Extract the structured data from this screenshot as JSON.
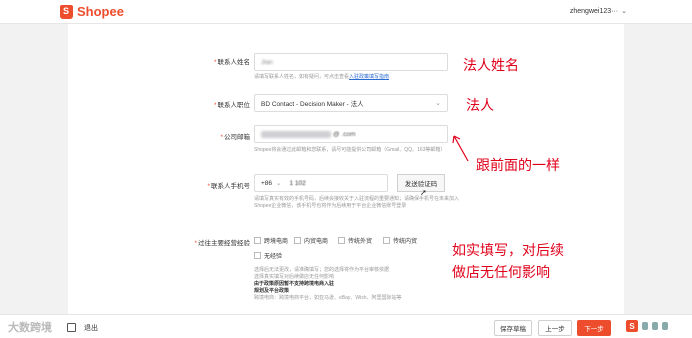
{
  "brand": {
    "name": "Shopee"
  },
  "user": {
    "name": "zhengwei123···"
  },
  "form": {
    "contact_name": {
      "label": "联系人姓名",
      "value_visible": "Jian",
      "hint_prefix": "请填写联系人姓名，如有疑问，可点击查看",
      "hint_link": "入驻政策填写指南"
    },
    "contact_title": {
      "label": "联系人职位",
      "value": "BD Contact - Decision Maker - 法人"
    },
    "company_email": {
      "label": "公司邮箱",
      "value_visible": "@    .com",
      "hint": "Shopee将会通过此邮箱和您联系，请尽可能提供公司邮箱（Gmail、QQ、163等邮箱）"
    },
    "contact_phone": {
      "label": "联系人手机号",
      "country_code": "+86",
      "value_visible": "1   102",
      "send_code_label": "发送验证码",
      "hint": "请填写真实有效的手机号码，后续会接收关于入驻流程的重要通知；请确保手机号在未来加入Shopee企业微信，该手机号也将作为后续用于平台企业微信账号登录"
    },
    "experience": {
      "label": "过往主要经营经验",
      "options": [
        "跨境电商",
        "内贸电商",
        "传统外贸",
        "传统内贸",
        "无经验"
      ],
      "hint_line1": "选择后无法更改，请准确填写；您的选择将作为平台审核依据",
      "hint_line2": "选择真实填写对后续做店无任何影响",
      "hint_bold1": "由于政策原因暂不支持跨境电商入驻",
      "hint_bold2": "规划及平台政策",
      "hint_line3": "跨境电商：跨境电商平台，如亚马逊、eBay、Wish、阿里国际站等"
    }
  },
  "annotations": {
    "name": "法人姓名",
    "title": "法人",
    "email_phone": "跟前面的一样",
    "experience_line1": "如实填写，对后续",
    "experience_line2": "做店无任何影响"
  },
  "footer": {
    "watermark": "大数跨境",
    "exit_label": "退出",
    "save_draft": "保存草稿",
    "prev": "上一步",
    "next": "下一步",
    "tray_s": "S"
  },
  "colors": {
    "brand": "#ee4d2d",
    "annotation": "#e0001a",
    "link": "#2a6bd1"
  }
}
